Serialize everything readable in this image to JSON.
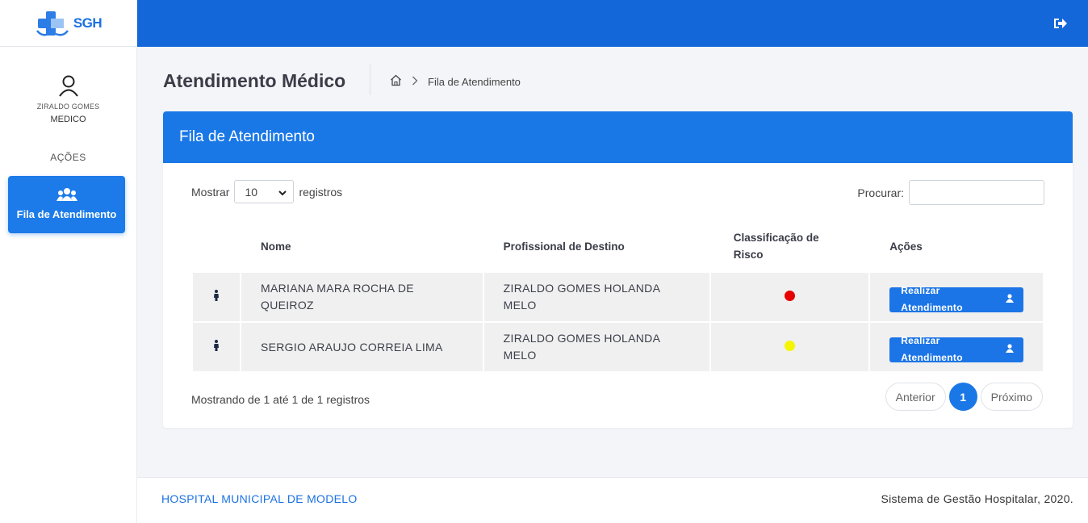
{
  "brand": {
    "logo_text": "SGH"
  },
  "user": {
    "name": "ZIRALDO GOMES",
    "role": "MEDICO"
  },
  "sidebar": {
    "section_title": "AÇÕES",
    "items": [
      {
        "label": "Fila de Atendimento",
        "icon": "users-icon",
        "active": true
      }
    ]
  },
  "topbar": {
    "logout_icon": "sign-out-icon"
  },
  "header": {
    "title": "Atendimento Médico",
    "breadcrumb": [
      {
        "icon": "home-icon"
      },
      {
        "label": "Fila de Atendimento"
      }
    ]
  },
  "card": {
    "title": "Fila de Atendimento",
    "length": {
      "prefix": "Mostrar",
      "value": "10",
      "suffix": "registros"
    },
    "search": {
      "label": "Procurar:",
      "value": ""
    },
    "columns": [
      "",
      "Nome",
      "Profissional de Destino",
      "Classificação de Risco",
      "Ações"
    ],
    "rows": [
      {
        "icon": "person-icon",
        "name": "MARIANA MARA ROCHA DE QUEIROZ",
        "professional": "ZIRALDO GOMES HOLANDA MELO",
        "risk_color": "#e60000",
        "action": "Realizar Atendimento"
      },
      {
        "icon": "person-icon",
        "name": "SERGIO ARAUJO CORREIA LIMA",
        "professional": "ZIRALDO GOMES HOLANDA MELO",
        "risk_color": "#f5f500",
        "action": "Realizar Atendimento"
      }
    ],
    "info": "Mostrando de 1 até 1 de 1 registros",
    "pagination": {
      "previous": "Anterior",
      "current": "1",
      "next": "Próximo"
    }
  },
  "footer": {
    "left": "HOSPITAL MUNICIPAL DE MODELO",
    "right": "Sistema de Gestão Hospitalar, 2020."
  },
  "colors": {
    "primary": "#1a78e6",
    "topbar": "#1467d9"
  }
}
